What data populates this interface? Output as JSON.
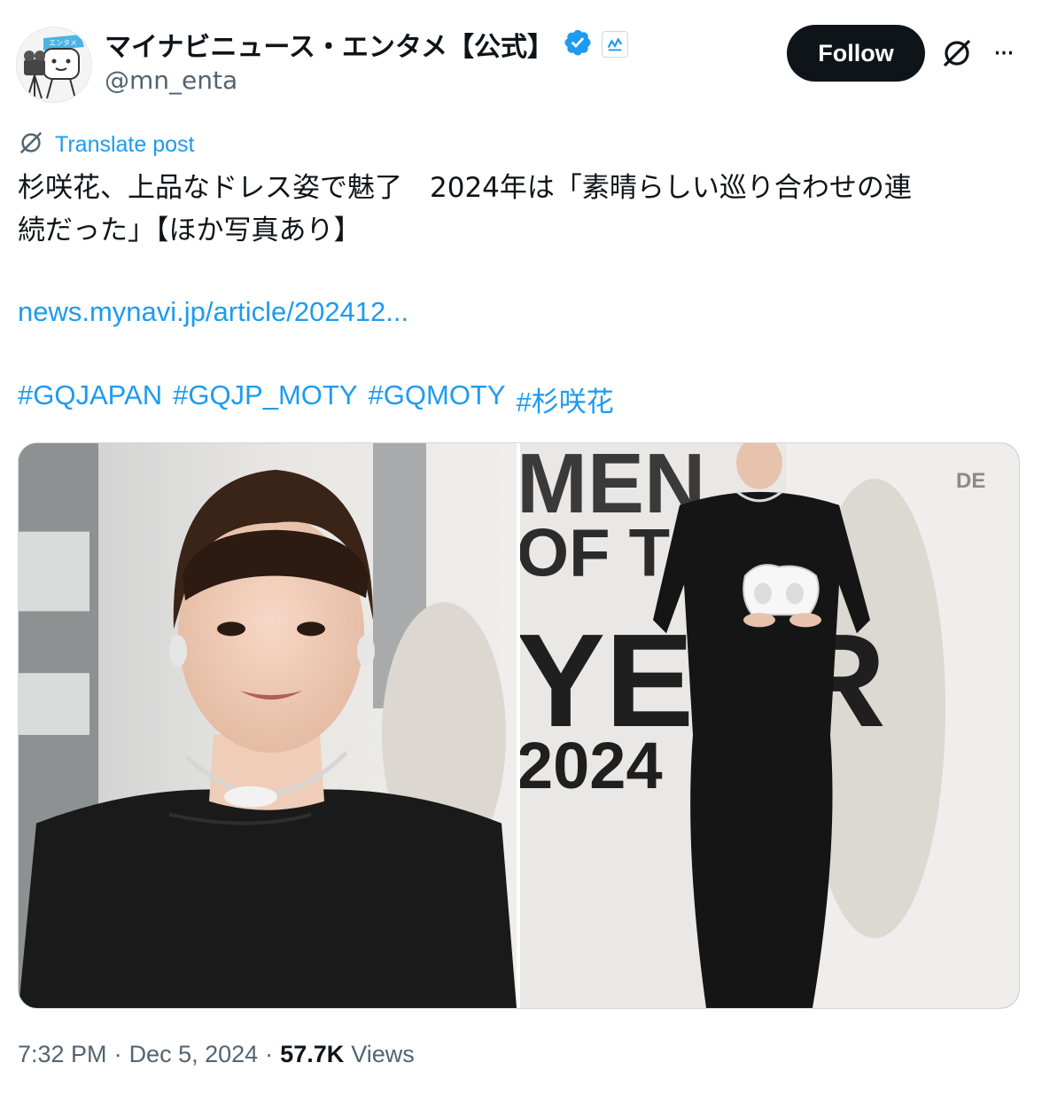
{
  "author": {
    "display_name": "マイナビニュース・エンタメ【公式】",
    "handle": "@mn_enta",
    "verified": true,
    "avatar_icon": "mascot-avatar-icon",
    "avatar_text": "エンタメ",
    "affiliate_badge_icon": "mynavi-affiliate-badge-icon"
  },
  "actions": {
    "follow_label": "Follow",
    "grok_icon": "grok-icon",
    "more_icon": "more-options-icon",
    "more_label": "···"
  },
  "translate": {
    "label": "Translate post",
    "icon": "globe-translate-icon"
  },
  "post": {
    "text_lines": [
      "杉咲花、上品なドレス姿で魅了　2024年は「素晴らしい巡り合わせの連",
      "続だった」【ほか写真あり】"
    ],
    "link": "news.mynavi.jp/article/202412...",
    "hashtags": [
      "#GQJAPAN",
      "#GQJP_MOTY",
      "#GQMOTY",
      "#杉咲花"
    ]
  },
  "media": {
    "left_photo": "closeup-photo",
    "right_photo": "full-length-photo",
    "backdrop_text": {
      "men": "MEN",
      "of_the": "OF TH",
      "year": "YEAR",
      "year_value": "2024",
      "de": "DE"
    }
  },
  "meta": {
    "time": "7:32 PM",
    "separator": "·",
    "date": "Dec 5, 2024",
    "views_count": "57.7K",
    "views_label": "Views"
  },
  "colors": {
    "accent": "#1d9bf0",
    "text": "#0f1419",
    "secondary": "#536471",
    "follow_bg": "#0f1419"
  }
}
